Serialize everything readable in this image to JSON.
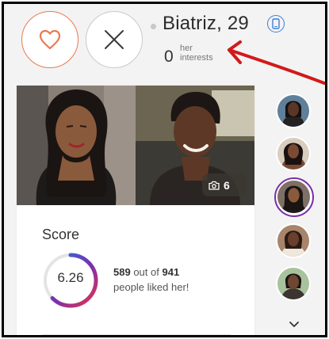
{
  "profile": {
    "name_age": "Biatriz, 29",
    "interests_count": "0",
    "interests_label_line1": "her",
    "interests_label_line2": "interests"
  },
  "actions": {
    "like_icon": "heart-icon",
    "pass_icon": "close-icon",
    "mobile_icon": "mobile-phone-icon"
  },
  "photos": {
    "count": "6",
    "count_icon": "camera-icon"
  },
  "score": {
    "title": "Score",
    "value": "6.26",
    "liked_count": "589",
    "out_of_text": "out of",
    "total_count": "941",
    "liked_text": "people liked her!",
    "gauge_fraction": 0.626
  },
  "rail": {
    "thumb_count": 5,
    "active_index": 2,
    "chevron_icon": "chevron-down-icon"
  },
  "colors": {
    "like_accent": "#e97a52",
    "mobile_badge": "#3b7fd6",
    "active_thumb": "#7b2ea8",
    "annotation": "#d11a1a",
    "gauge_start": "#1f7de0",
    "gauge_mid": "#7a2fb0",
    "gauge_end": "#e8324a"
  }
}
